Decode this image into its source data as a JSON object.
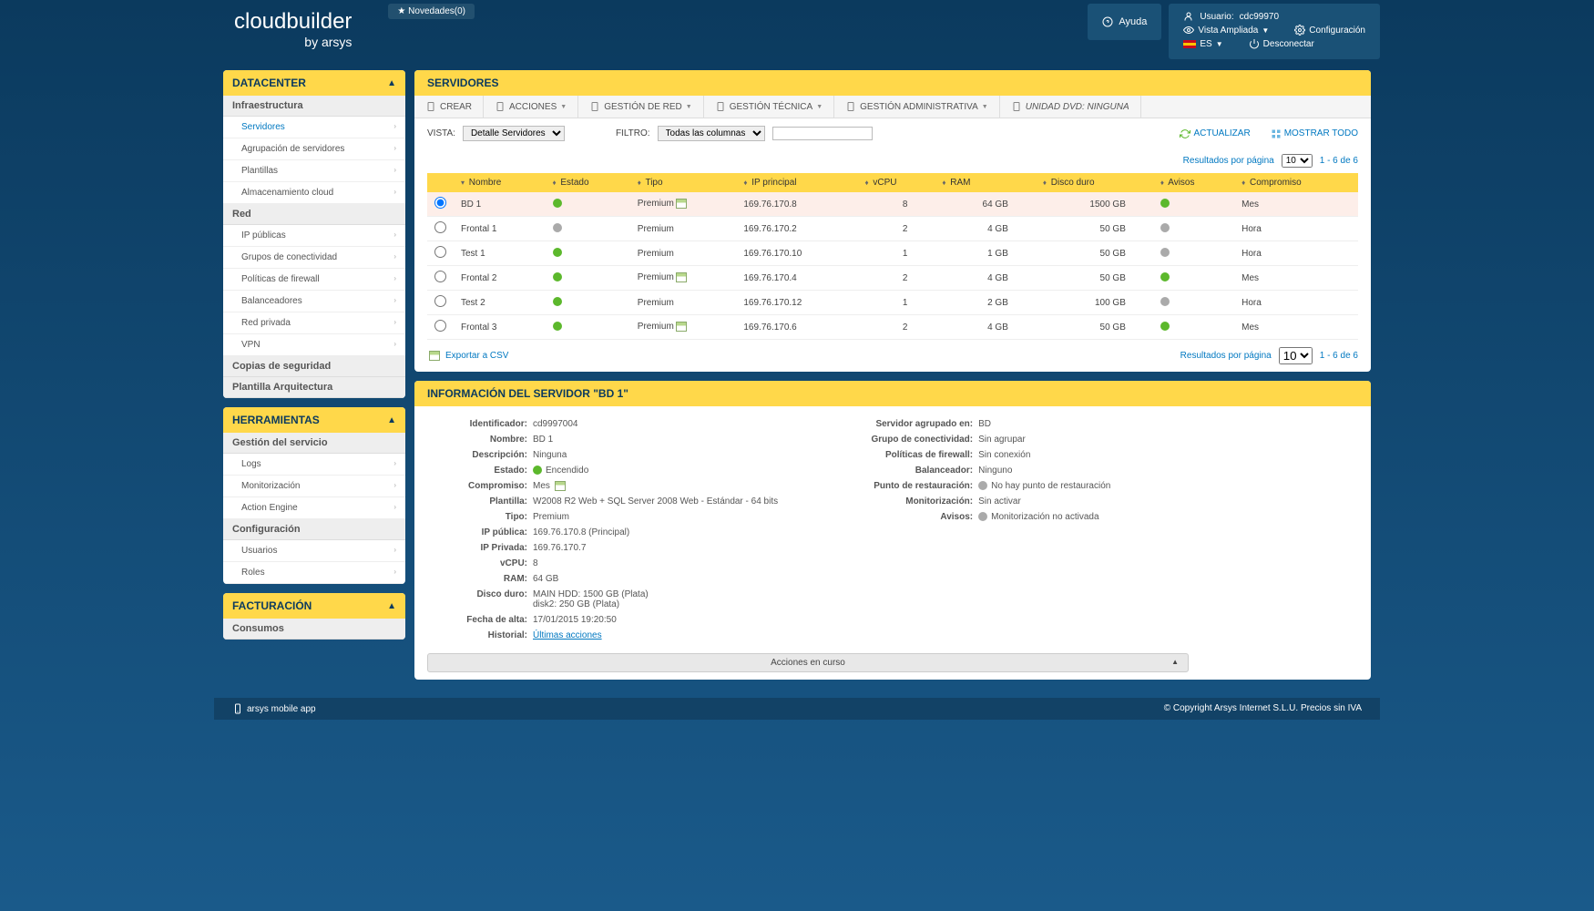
{
  "header": {
    "logo_main": "cloudbuilder",
    "logo_by": "by arsys",
    "novedades": "★ Novedades(0)",
    "ayuda": "Ayuda",
    "user_label": "Usuario:",
    "user_value": "cdc99970",
    "vista_ampliada": "Vista Ampliada",
    "configuracion": "Configuración",
    "lang": "ES",
    "desconectar": "Desconectar"
  },
  "sidebar": {
    "datacenter": {
      "title": "DATACENTER",
      "sections": [
        {
          "label": "Infraestructura",
          "items": [
            "Servidores",
            "Agrupación de servidores",
            "Plantillas",
            "Almacenamiento cloud"
          ],
          "active": 0
        },
        {
          "label": "Red",
          "items": [
            "IP públicas",
            "Grupos de conectividad",
            "Políticas de firewall",
            "Balanceadores",
            "Red privada",
            "VPN"
          ]
        },
        {
          "label": "Copias de seguridad",
          "items": []
        },
        {
          "label": "Plantilla Arquitectura",
          "items": []
        }
      ]
    },
    "herramientas": {
      "title": "HERRAMIENTAS",
      "sections": [
        {
          "label": "Gestión del servicio",
          "items": [
            "Logs",
            "Monitorización",
            "Action Engine"
          ]
        },
        {
          "label": "Configuración",
          "items": [
            "Usuarios",
            "Roles"
          ]
        }
      ]
    },
    "facturacion": {
      "title": "FACTURACIÓN",
      "sections": [
        {
          "label": "Consumos",
          "items": []
        }
      ]
    }
  },
  "servers": {
    "title": "SERVIDORES",
    "toolbar": [
      {
        "label": "CREAR"
      },
      {
        "label": "ACCIONES",
        "dd": true
      },
      {
        "label": "GESTIÓN DE RED",
        "dd": true
      },
      {
        "label": "GESTIÓN TÉCNICA",
        "dd": true
      },
      {
        "label": "GESTIÓN ADMINISTRATIVA",
        "dd": true
      },
      {
        "label": "UNIDAD DVD: NINGUNA",
        "italic": true
      }
    ],
    "vista_label": "VISTA:",
    "vista_value": "Detalle Servidores",
    "filtro_label": "FILTRO:",
    "filtro_value": "Todas las columnas",
    "actualizar": "ACTUALIZAR",
    "mostrar_todo": "MOSTRAR TODO",
    "resultados_label": "Resultados por página",
    "page_size": "10",
    "range": "1 - 6 de 6",
    "columns": [
      "",
      "Nombre",
      "Estado",
      "Tipo",
      "IP principal",
      "vCPU",
      "RAM",
      "Disco duro",
      "Avisos",
      "Compromiso"
    ],
    "rows": [
      {
        "sel": true,
        "nombre": "BD 1",
        "estado": "green",
        "tipo": "Premium",
        "cal": true,
        "ip": "169.76.170.8",
        "vcpu": "8",
        "ram": "64 GB",
        "disco": "1500 GB",
        "avisos": "green",
        "comp": "Mes"
      },
      {
        "sel": false,
        "nombre": "Frontal 1",
        "estado": "gray",
        "tipo": "Premium",
        "cal": false,
        "ip": "169.76.170.2",
        "vcpu": "2",
        "ram": "4 GB",
        "disco": "50 GB",
        "avisos": "gray",
        "comp": "Hora"
      },
      {
        "sel": false,
        "nombre": "Test 1",
        "estado": "green",
        "tipo": "Premium",
        "cal": false,
        "ip": "169.76.170.10",
        "vcpu": "1",
        "ram": "1 GB",
        "disco": "50 GB",
        "avisos": "gray",
        "comp": "Hora"
      },
      {
        "sel": false,
        "nombre": "Frontal 2",
        "estado": "green",
        "tipo": "Premium",
        "cal": true,
        "ip": "169.76.170.4",
        "vcpu": "2",
        "ram": "4 GB",
        "disco": "50 GB",
        "avisos": "green",
        "comp": "Mes"
      },
      {
        "sel": false,
        "nombre": "Test 2",
        "estado": "green",
        "tipo": "Premium",
        "cal": false,
        "ip": "169.76.170.12",
        "vcpu": "1",
        "ram": "2 GB",
        "disco": "100 GB",
        "avisos": "gray",
        "comp": "Hora"
      },
      {
        "sel": false,
        "nombre": "Frontal 3",
        "estado": "green",
        "tipo": "Premium",
        "cal": true,
        "ip": "169.76.170.6",
        "vcpu": "2",
        "ram": "4 GB",
        "disco": "50 GB",
        "avisos": "green",
        "comp": "Mes"
      }
    ],
    "export": "Exportar a CSV"
  },
  "info": {
    "title": "INFORMACIÓN DEL SERVIDOR \"BD 1\"",
    "left": [
      {
        "lbl": "Identificador:",
        "val": "cd9997004"
      },
      {
        "lbl": "Nombre:",
        "val": "BD 1"
      },
      {
        "lbl": "Descripción:",
        "val": "Ninguna"
      },
      {
        "lbl": "Estado:",
        "val": "Encendido",
        "dot": "green"
      },
      {
        "lbl": "Compromiso:",
        "val": "Mes",
        "cal": true
      },
      {
        "lbl": "Plantilla:",
        "val": "W2008 R2 Web + SQL Server 2008 Web - Estándar - 64 bits"
      },
      {
        "lbl": "Tipo:",
        "val": "Premium"
      },
      {
        "lbl": "IP pública:",
        "val": "169.76.170.8 (Principal)"
      },
      {
        "lbl": "IP Privada:",
        "val": "169.76.170.7"
      },
      {
        "lbl": "vCPU:",
        "val": "8"
      },
      {
        "lbl": "RAM:",
        "val": "64 GB"
      },
      {
        "lbl": "Disco duro:",
        "val": "MAIN HDD: 1500 GB (Plata)\ndisk2: 250 GB (Plata)"
      },
      {
        "lbl": "Fecha de alta:",
        "val": "17/01/2015 19:20:50"
      },
      {
        "lbl": "Historial:",
        "val": "Últimas acciones",
        "link": true
      }
    ],
    "right": [
      {
        "lbl": "Servidor agrupado en:",
        "val": "BD"
      },
      {
        "lbl": "Grupo de conectividad:",
        "val": "Sin agrupar"
      },
      {
        "lbl": "Políticas de firewall:",
        "val": "Sin conexión"
      },
      {
        "lbl": "Balanceador:",
        "val": "Ninguno"
      },
      {
        "lbl": "Punto de restauración:",
        "val": "No hay punto de restauración",
        "dot": "gray"
      },
      {
        "lbl": "Monitorización:",
        "val": "Sin activar"
      },
      {
        "lbl": "Avisos:",
        "val": "Monitorización no activada",
        "dot": "gray"
      }
    ],
    "acciones": "Acciones en curso"
  },
  "footer": {
    "app": "arsys mobile app",
    "copy": "© Copyright Arsys Internet S.L.U. Precios sin IVA"
  }
}
